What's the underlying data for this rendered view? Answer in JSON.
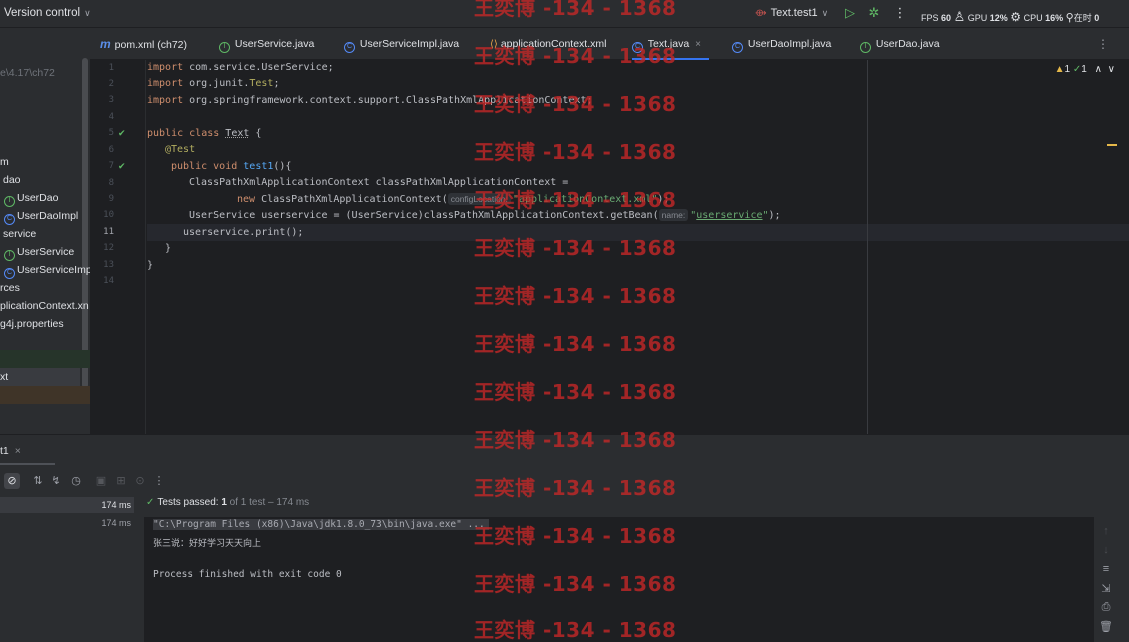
{
  "topbar": {
    "version_control": "Version control",
    "run_config": "Text.test1",
    "stats": {
      "fps_label": "FPS",
      "fps": "60",
      "gpu_label": "GPU",
      "gpu": "12%",
      "cpu_label": "CPU",
      "cpu": "16%",
      "extra": "在时",
      "extra_num": "0"
    }
  },
  "project": {
    "path": "e\\4.17\\ch72",
    "items": [
      "m",
      "dao",
      "UserDao",
      "UserDaoImpl",
      "service",
      "UserService",
      "UserServiceImp",
      "rces",
      "plicationContext.xn",
      "g4j.properties",
      "xt"
    ]
  },
  "tabs": [
    "pom.xml (ch72)",
    "UserService.java",
    "UserServiceImpl.java",
    "applicationContext.xml",
    "Text.java",
    "UserDaoImpl.java",
    "UserDao.java"
  ],
  "editor": {
    "line_numbers": [
      "1",
      "2",
      "3",
      "4",
      "5",
      "6",
      "7",
      "8",
      "9",
      "10",
      "11",
      "12",
      "13",
      "14"
    ],
    "inspections": {
      "warnings": "1",
      "ok": "1"
    },
    "l1_kw": "import",
    "l1_rest": " com.service.UserService;",
    "l2_kw": "import",
    "l2_rest": " org.junit.",
    "l2_cls": "Test",
    "l2_end": ";",
    "l3_kw": "import",
    "l3_rest": " org.springframework.context.support.ClassPathXmlApplicationContext;",
    "l5_kw1": "public",
    "l5_kw2": "class",
    "l5_name": "Text",
    "l5_end": " {",
    "l6_ann": "@Test",
    "l7_kw1": "public",
    "l7_kw2": "void",
    "l7_fn": "test1",
    "l7_end": "(){",
    "l8": "ClassPathXmlApplicationContext classPathXmlApplicationContext =",
    "l9_kw": "new",
    "l9_rest": " ClassPathXmlApplicationContext(",
    "l9_hint": "configLocation:",
    "l9_str": "\"applicationContext.xml\"",
    "l9_end": ");",
    "l10_pre": "UserService userservice = (UserService)classPathXmlApplicationContext.getBean(",
    "l10_hint": "name:",
    "l10_str_q1": "\"",
    "l10_str": "userservice",
    "l10_str_q2": "\"",
    "l10_end": ");",
    "l11": "userservice.print();",
    "l12": "}",
    "l13": "}"
  },
  "run_panel": {
    "tab": "t1",
    "tests": [
      {
        "time": "174 ms"
      },
      {
        "time": "174 ms"
      }
    ],
    "status": {
      "main": "Tests passed:",
      "count": "1",
      "sub": " of 1 test – 174 ms"
    },
    "console": {
      "cmd": "\"C:\\Program Files (x86)\\Java\\jdk1.8.0_73\\bin\\java.exe\" ...",
      "out": "张三说：好好学习天天向上",
      "exit": "Process finished with exit code 0"
    }
  },
  "watermark": "王奕博 -134 - 1368"
}
